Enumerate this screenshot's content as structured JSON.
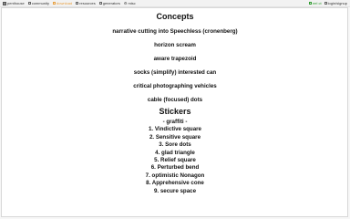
{
  "nav": {
    "left": [
      {
        "label": "penthouse",
        "icon": "logo-icon"
      },
      {
        "label": "community",
        "icon": "square-icon"
      },
      {
        "label": "download",
        "icon": "square-icon",
        "active": true
      },
      {
        "label": "resources",
        "icon": "square-icon"
      },
      {
        "label": "generators",
        "icon": "square-icon"
      },
      {
        "label": "misc",
        "icon": "gear-icon"
      }
    ],
    "right": [
      {
        "label": "eel ct",
        "icon": "square-icon"
      },
      {
        "label": "login/signup",
        "icon": "square-icon"
      }
    ],
    "active_color": "#e8a040",
    "status_color": "#2c9a2c"
  },
  "concepts": {
    "heading": "Concepts",
    "items": [
      "narrative cutting into Speechless (cronenberg)",
      "horizon scream",
      "aware trapezoid",
      "socks (simplify) interested can",
      "critical photographing vehicles",
      "cable (focused) dots"
    ]
  },
  "stickers": {
    "heading": "Stickers",
    "intro": "- graffiti -",
    "items": [
      "1. Vindictive square",
      "2. Sensitive square",
      "3. Sore dots",
      "4. glad triangle",
      "5. Relief square",
      "6. Perturbed bend",
      "7. optimistic Nonagon",
      "8. Apprehensive cone",
      "9. secure space"
    ]
  }
}
